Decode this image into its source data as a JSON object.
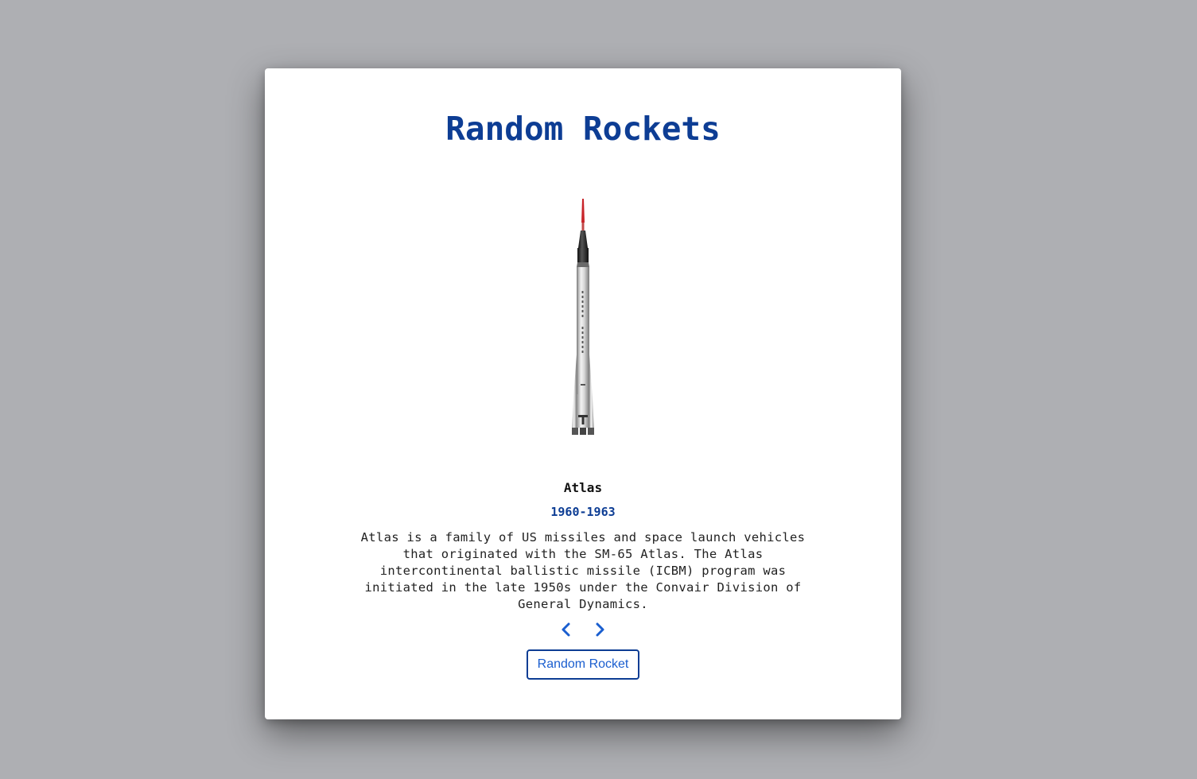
{
  "app": {
    "title": "Random Rockets"
  },
  "rocket": {
    "name": "Atlas",
    "years": "1960-1963",
    "description": "Atlas is a family of US missiles and space launch vehicles that originated with the SM-65 Atlas. The Atlas intercontinental ballistic missile (ICBM) program was initiated in the late 1950s under the Convair Division of General Dynamics.",
    "image_icon": "rocket-image"
  },
  "controls": {
    "prev_icon": "chevron-left-icon",
    "next_icon": "chevron-right-icon",
    "random_label": "Random Rocket"
  },
  "colors": {
    "background": "#aeafb3",
    "card": "#ffffff",
    "title": "#0d3d94",
    "accent": "#1a5ecf"
  }
}
